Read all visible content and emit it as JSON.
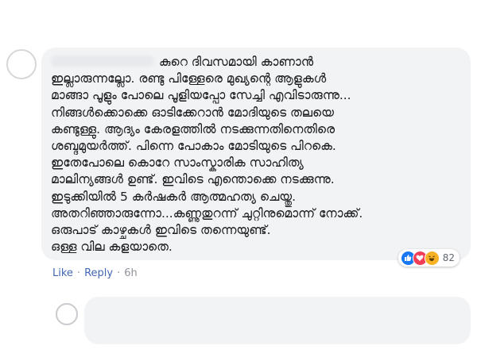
{
  "comment": {
    "text": "കുറെ ദിവസമായി കാണാൻ\nഇല്ലാരുന്നല്ലോ. രണ്ടു പിള്ളേരെ മുഖ്യന്റെ ആളുകൾ\nമാങ്ങാ പൂളും പോലെ പൂളിയപ്പോ സേച്ചി എവിടാരുന്നു...\nനിങ്ങൾക്കൊക്കെ ഓടിക്കേറാൻ മോദിയുടെ തലയെ\nകണ്ടുള്ളു. ആദ്യം കേരളത്തിൽ നടക്കുന്നതിനെതിരെ\nശബ്ദമുയർത്ത്. പിന്നെ പോകാം മോടിയുടെ പിറകെ.\nഇതേപോലെ കൊറേ സാംസ്കാരിക സാഹിത്യ\nമാലിന്യങ്ങൾ ഉണ്ട്. ഇവിടെ എന്തൊക്കെ നടക്കുന്നു.\nഇടുക്കിയിൽ 5 കർഷകർ ആത്മഹത്യ ചെയ്തു.\nഅതറിഞ്ഞാരുന്നോ...കണ്ണുതുറന്ന് ചുറ്റിനുമൊന്ന് നോക്ക്.\nഒരുപാട് കാഴ്ചകൾ ഇവിടെ തന്നെയുണ്ട്.\nഒള്ള വില കളയാതെ."
  },
  "reactions": {
    "icons": [
      "like-icon",
      "love-icon",
      "haha-icon"
    ],
    "count": "82"
  },
  "actions": {
    "like": "Like",
    "reply": "Reply",
    "separator": "·",
    "time": "6h"
  },
  "colors": {
    "like": "#1877f2",
    "love": "#f33e58",
    "haha": "#f7b125",
    "link": "#4267b2"
  }
}
